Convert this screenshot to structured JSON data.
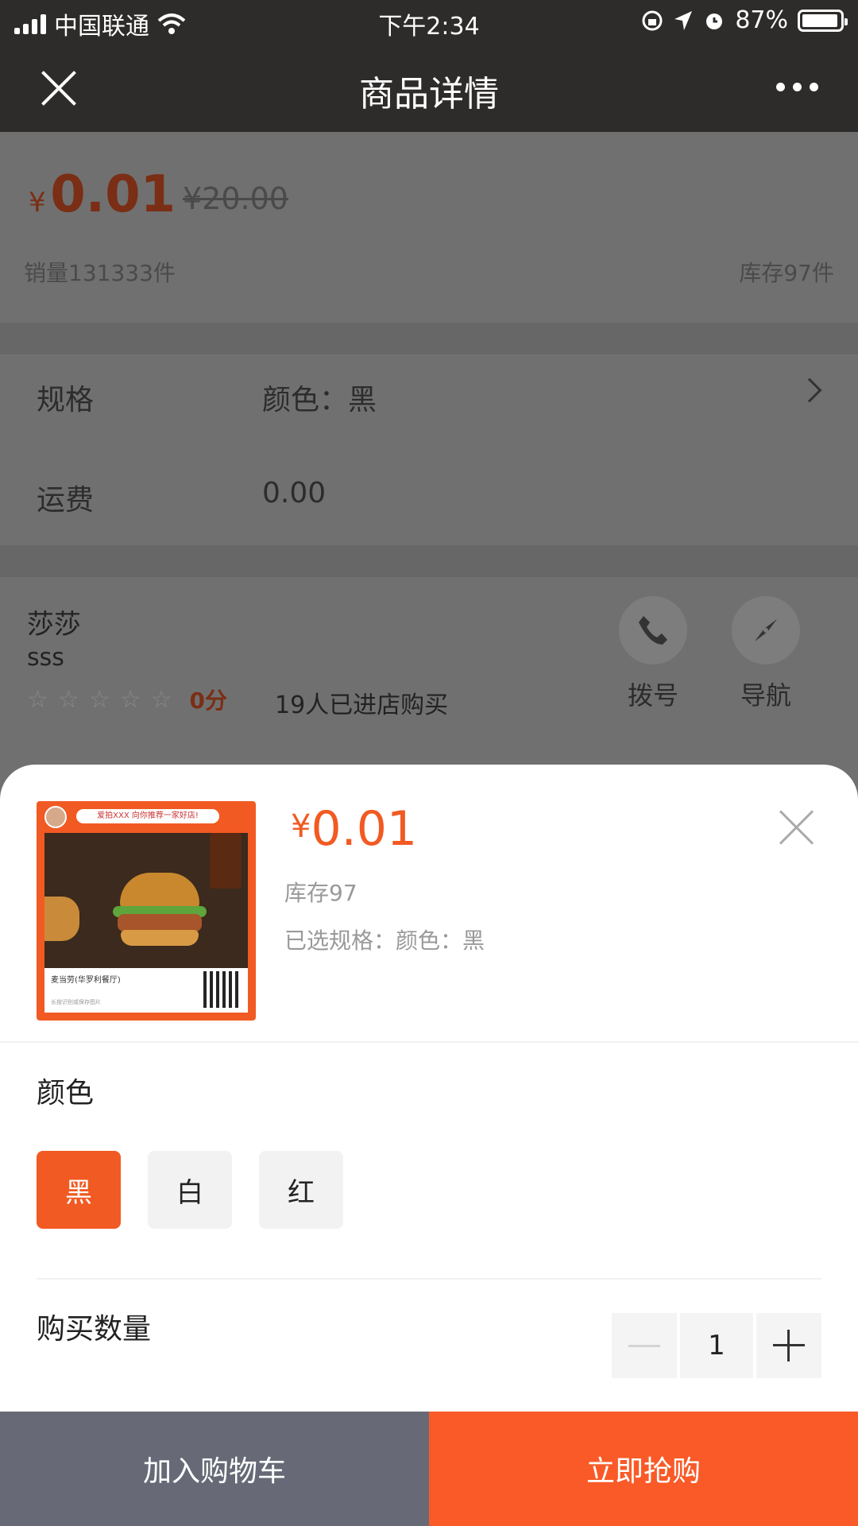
{
  "status_bar": {
    "carrier": "中国联通",
    "time": "下午2:34",
    "battery": "87%"
  },
  "nav": {
    "title": "商品详情"
  },
  "background_page": {
    "price_symbol": "¥",
    "price": "0.01",
    "original_price": "¥20.00",
    "sales": "销量131333件",
    "stock": "库存97件",
    "spec_label": "规格",
    "spec_value": "颜色：黑",
    "shipping_label": "运费",
    "shipping_value": "0.00",
    "shop_name": "莎莎",
    "shop_subtitle": "sss",
    "rating_score": "0分",
    "visitors": "19人已进店购买",
    "call_label": "拨号",
    "navigate_label": "导航"
  },
  "thumbnail": {
    "banner_text": "爱拍XXX 向你推荐一家好店!",
    "store_name": "麦当劳(华罗利餐厅)",
    "note": "长按识别或保存图片"
  },
  "sheet": {
    "price_symbol": "¥",
    "price": "0.01",
    "stock": "库存97",
    "selected_spec": "已选规格：颜色：黑",
    "color_label": "颜色",
    "color_options": [
      "黑",
      "白",
      "红"
    ],
    "selected_color_index": 0,
    "quantity_label": "购买数量",
    "quantity": "1"
  },
  "footer": {
    "add_to_cart": "加入购物车",
    "buy_now": "立即抢购"
  },
  "colors": {
    "accent": "#f15a22",
    "cart_button": "#676a76",
    "nav_bg": "#2e2c2b"
  }
}
